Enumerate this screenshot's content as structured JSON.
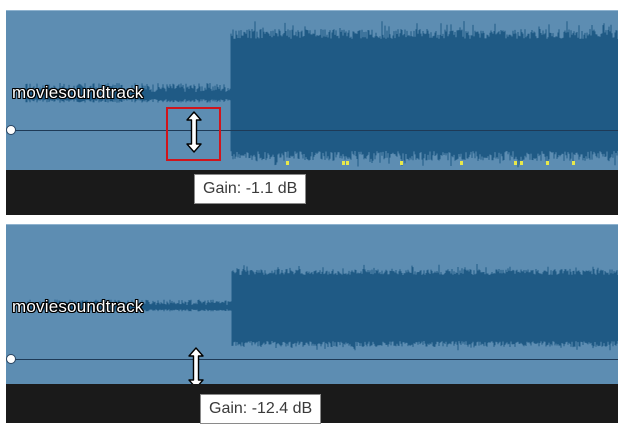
{
  "panels": [
    {
      "clip_name": "moviesoundtrack",
      "tooltip": "Gain: -1.1 dB",
      "highlighted": true
    },
    {
      "clip_name": "moviesoundtrack",
      "tooltip": "Gain: -12.4 dB",
      "highlighted": false
    }
  ],
  "colors": {
    "clip_background": "#5d8db2",
    "waveform": "#1f5a85",
    "envelope_line": "#1e3a57",
    "highlight": "#d1141b",
    "peak_marker": "#e8e84a",
    "track_bar": "#1a1a1a"
  },
  "icons": {
    "resize_cursor": "vertical-double-arrow-icon"
  }
}
